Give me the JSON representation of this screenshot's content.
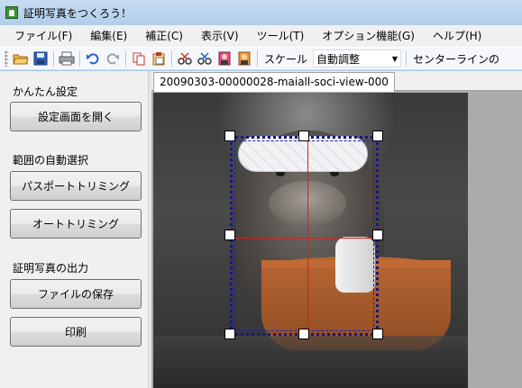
{
  "window": {
    "title": "証明写真をつくろう！",
    "icon": "app-icon"
  },
  "menu": [
    {
      "label": "ファイル(F)"
    },
    {
      "label": "編集(E)"
    },
    {
      "label": "補正(C)"
    },
    {
      "label": "表示(V)"
    },
    {
      "label": "ツール(T)"
    },
    {
      "label": "オプション機能(G)"
    },
    {
      "label": "ヘルプ(H)"
    }
  ],
  "toolbar": {
    "icons": [
      "open-folder-icon",
      "save-icon",
      "print-icon",
      "undo-icon",
      "redo-icon",
      "copy-icon",
      "paste-icon",
      "cut-person-icon",
      "cut-person-alt-icon",
      "portrait-pink-icon",
      "portrait-orange-icon"
    ],
    "scale_label": "スケール",
    "scale_select_value": "自動調整",
    "centerline_label": "センターラインの"
  },
  "sidebar": {
    "section1_title": "かんたん設定",
    "open_settings_button": "設定画面を開く",
    "section2_title": "範囲の自動選択",
    "passport_trim_button": "パスポートトリミング",
    "auto_trim_button": "オートトリミング",
    "section3_title": "証明写真の出力",
    "save_file_button": "ファイルの保存",
    "print_button": "印刷"
  },
  "document": {
    "tab_label": "20090303-00000028-maiall-soci-view-000"
  },
  "colors": {
    "crop_border": "#17187a",
    "guide_line": "#e01b1b"
  }
}
